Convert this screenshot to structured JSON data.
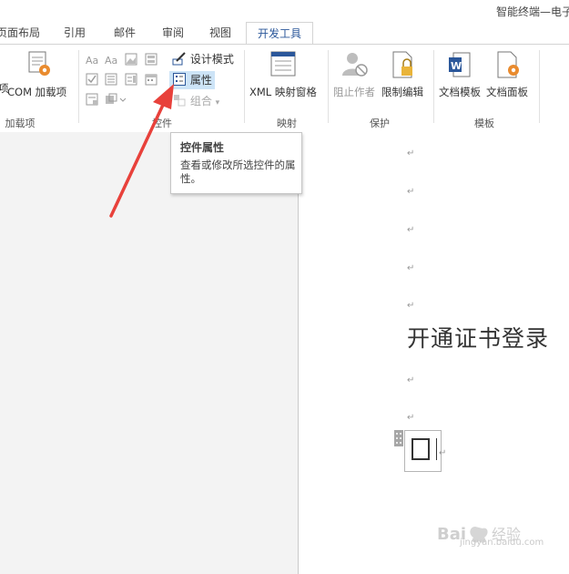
{
  "window": {
    "doc_title": "智能终端—电子"
  },
  "tabs": [
    {
      "label": "页面布局"
    },
    {
      "label": "引用"
    },
    {
      "label": "邮件"
    },
    {
      "label": "审阅"
    },
    {
      "label": "视图"
    },
    {
      "label": "开发工具",
      "active": true
    }
  ],
  "ribbon": {
    "addins": {
      "label": "加载项",
      "com_button": "COM 加载项",
      "left_partial": "项"
    },
    "controls": {
      "label": "控件",
      "design_mode": "设计模式",
      "properties": "属性",
      "group": "组合"
    },
    "mapping": {
      "label": "映射",
      "xml_pane": "XML 映射窗格"
    },
    "protect": {
      "label": "保护",
      "block_authors": "阻止作者",
      "restrict_editing": "限制编辑"
    },
    "templates": {
      "label": "模板",
      "doc_template": "文档模板",
      "doc_panel": "文档面板"
    }
  },
  "tooltip": {
    "title": "控件属性",
    "description": "查看或修改所选控件的属性。"
  },
  "document": {
    "paragraph_mark": "↵",
    "heading": "开通证书登录"
  },
  "watermark": {
    "brand": "Baidu经验",
    "url": "jingyan.baidu.com"
  },
  "colors": {
    "accent": "#2b579a",
    "highlight": "#cde4f7",
    "arrow": "#e8413b"
  }
}
